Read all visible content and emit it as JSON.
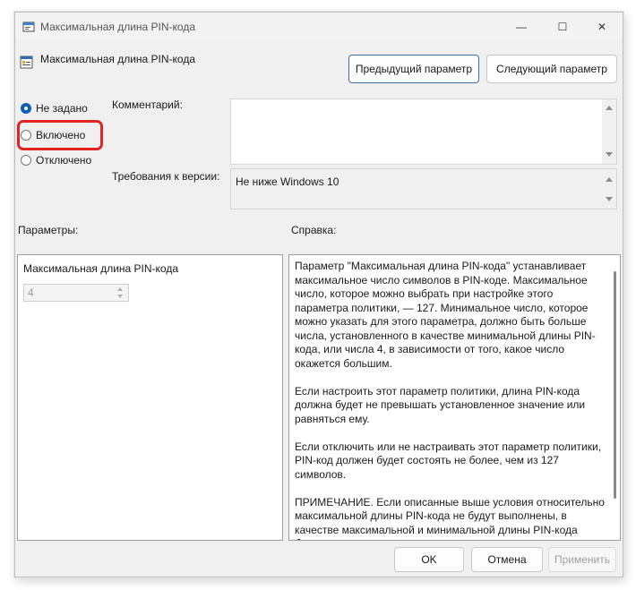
{
  "window": {
    "title": "Максимальная длина PIN-кода",
    "caption_buttons": {
      "minimize": "—",
      "maximize": "☐",
      "close": "✕"
    }
  },
  "header": {
    "policy_title": "Максимальная длина PIN-кода",
    "prev_button": "Предыдущий параметр",
    "next_button": "Следующий параметр"
  },
  "state_options": [
    {
      "label": "Не задано",
      "checked": true
    },
    {
      "label": "Включено",
      "checked": false
    },
    {
      "label": "Отключено",
      "checked": false
    }
  ],
  "comment": {
    "label": "Комментарий:",
    "value": ""
  },
  "requirements": {
    "label": "Требования к версии:",
    "value": "Не ниже Windows 10"
  },
  "parameters": {
    "label": "Параметры:",
    "field_label": "Максимальная длина PIN-кода",
    "field_value": "4"
  },
  "help": {
    "label": "Справка:",
    "paragraphs": [
      "Параметр \"Максимальная длина PIN-кода\" устанавливает максимальное число символов в PIN-коде. Максимальное число, которое можно выбрать при настройке этого параметра политики, — 127. Минимальное число, которое можно указать для этого параметра, должно быть больше числа, установленного в качестве минимальной длины PIN-кода, или числа 4, в зависимости от того, какое число окажется большим.",
      "Если настроить этот параметр политики, длина PIN-кода должна будет не превышать установленное значение или равняться ему.",
      "Если отключить или не настраивать этот параметр политики, PIN-код должен будет состоять не более, чем из 127 символов.",
      "ПРИМЕЧАНИЕ. Если описанные выше условия относительно максимальной длины PIN-кода не будут выполнены, в качестве максимальной и минимальной длины PIN-кода будут использоваться значения по умолчанию."
    ]
  },
  "footer": {
    "ok": "OK",
    "cancel": "Отмена",
    "apply": "Применить"
  },
  "colors": {
    "accent": "#0a5fb6",
    "highlight": "#e32222"
  }
}
